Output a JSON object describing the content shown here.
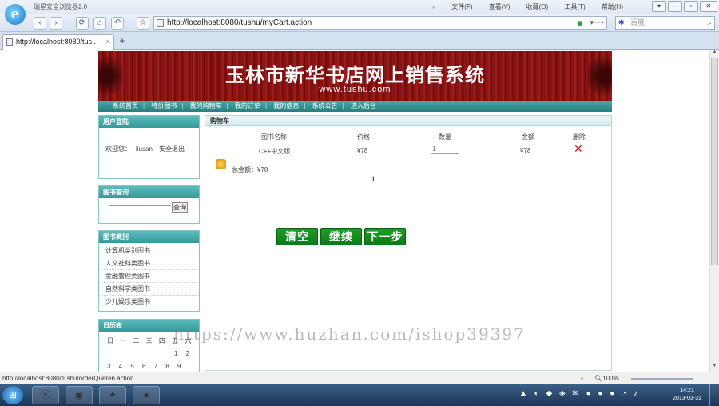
{
  "window": {
    "title": "瑞星安全浏览器2.0",
    "menu": [
      "文件(F)",
      "查看(V)",
      "收藏(O)",
      "工具(T)",
      "帮助(H)"
    ],
    "menu_more": "»",
    "controls": {
      "pin": "▾",
      "minimize": "—",
      "restore": "▫",
      "close": "✕"
    }
  },
  "toolbar": {
    "back": "‹",
    "forward": "›",
    "refresh": "⟳",
    "home": "⌂",
    "undo": "↶",
    "star": "☆",
    "address": "http://localhost:8080/tushu/myCart.action",
    "search_placeholder": "百度"
  },
  "tabs": [
    {
      "label": "http://localhost:8080/tus..."
    }
  ],
  "new_tab": "+",
  "site": {
    "title": "玉林市新华书店网上销售系统",
    "url": "www.tushu.com",
    "nav": [
      "系统首页",
      "特价图书",
      "我的购物车",
      "我的订单",
      "我的信息",
      "系统公告",
      "进入后台"
    ]
  },
  "sidebar": {
    "login": {
      "header": "用户登陆",
      "welcome": "欢迎您：",
      "user": "liusan",
      "logout": "安全退出"
    },
    "query": {
      "header": "图书查询",
      "button": "查询"
    },
    "categories": {
      "header": "图书类别",
      "items": [
        "计算机类别图书",
        "人文社科类图书",
        "金融管理类图书",
        "自然科学类图书",
        "少儿娱乐类图书"
      ]
    },
    "calendar": {
      "header": "日历表",
      "weekdays": "日 一 二 三 四 五 六",
      "row1": "1 2",
      "row2": "3 4 5 6 7 8 9"
    }
  },
  "cart": {
    "header": "购物车",
    "columns": [
      "图书名称",
      "价格",
      "数量",
      "金额",
      "删除"
    ],
    "rows": [
      {
        "name": "C++中文版",
        "price": "¥78",
        "qty": "1",
        "amount": "¥78"
      }
    ],
    "total_label": "总金额：¥78",
    "buttons": [
      "清空",
      "继续",
      "下一步"
    ]
  },
  "watermark": "https://www.huzhan.com/ishop39397",
  "status": {
    "text": "http://localhost:8080/tushu/orderQueren.action",
    "zoom": "100%"
  },
  "taskbar": {
    "clock_time": "14:21",
    "clock_date": "2013-03-31"
  }
}
